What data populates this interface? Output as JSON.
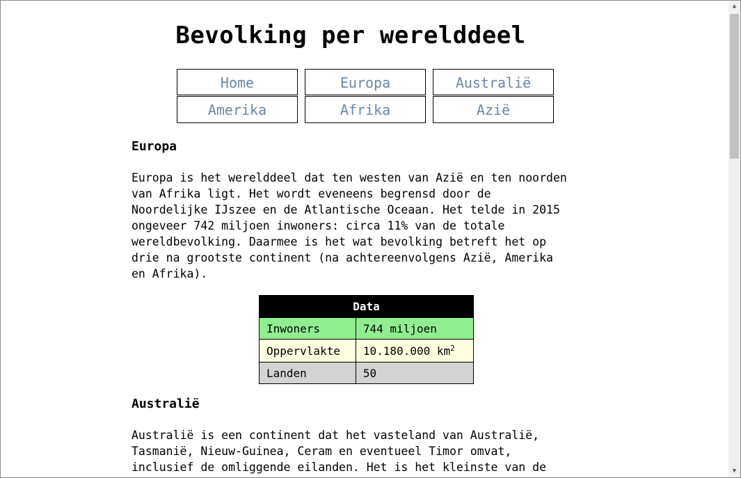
{
  "page": {
    "title": "Bevolking per werelddeel"
  },
  "nav": {
    "items": [
      "Home",
      "Europa",
      "Australië",
      "Amerika",
      "Afrika",
      "Azië"
    ]
  },
  "sections": [
    {
      "title": "Europa",
      "text": "Europa is het werelddeel dat ten westen van Azië en ten noorden\nvan Afrika ligt. Het wordt eveneens begrensd door de\nNoordelijke IJszee en de Atlantische Oceaan. Het telde in 2015\nongeveer 742 miljoen inwoners: circa 11% van de totale\nwereldbevolking. Daarmee is het wat bevolking betreft het op\ndrie na grootste continent (na achtereenvolgens Azië, Amerika\nen Afrika).",
      "table": {
        "header": "Data",
        "rows": [
          {
            "key": "Inwoners",
            "value": "744 miljoen"
          },
          {
            "key": "Oppervlakte",
            "value": "10.180.000 km",
            "sup": "2"
          },
          {
            "key": "Landen",
            "value": "50"
          }
        ],
        "row_colors": [
          "#90ee90",
          "#ffffe0",
          "#d3d3d3"
        ]
      }
    },
    {
      "title": "Australië",
      "text": "Australië is een continent dat het vasteland van Australië,\nTasmanië, Nieuw-Guinea, Ceram en eventueel Timor omvat,\ninclusief de omliggende eilanden. Het is het kleinste van de"
    }
  ],
  "colors": {
    "link": "#6b86a6",
    "header_bg": "#000000"
  },
  "scrollbar": {
    "up_icon": "▲",
    "down_icon": "▼"
  }
}
